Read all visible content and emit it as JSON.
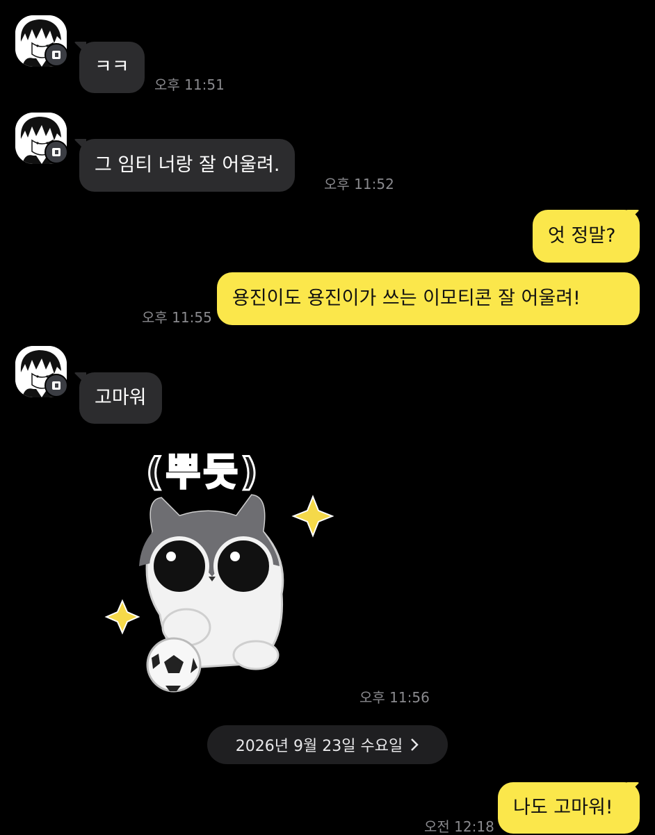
{
  "colors": {
    "background": "#000000",
    "incoming_bubble": "#2c2c2e",
    "outgoing_bubble": "#fbe74b",
    "timestamp": "#8a8a8e"
  },
  "messages": [
    {
      "direction": "incoming",
      "text": "ㅋㅋ",
      "time": "오후 11:51"
    },
    {
      "direction": "incoming",
      "text": "그 임티 너랑 잘 어울려.",
      "time": "오후 11:52"
    },
    {
      "direction": "outgoing",
      "text": "엇 정말?",
      "time": ""
    },
    {
      "direction": "outgoing",
      "text": "용진이도 용진이가 쓰는 이모티콘 잘 어울려!",
      "time": "오후 11:55"
    },
    {
      "direction": "incoming",
      "text": "고마워",
      "time": ""
    },
    {
      "direction": "incoming",
      "sticker": {
        "caption": "(뿌듯)",
        "icon": "cat-with-soccer-ball-sticker"
      },
      "time": "오후 11:56"
    },
    {
      "direction": "outgoing",
      "text": "나도 고마워!",
      "time": "오전 12:18"
    }
  ],
  "date_divider": {
    "label": "2026년 9월 23일 수요일",
    "icon": "chevron-right-icon"
  }
}
